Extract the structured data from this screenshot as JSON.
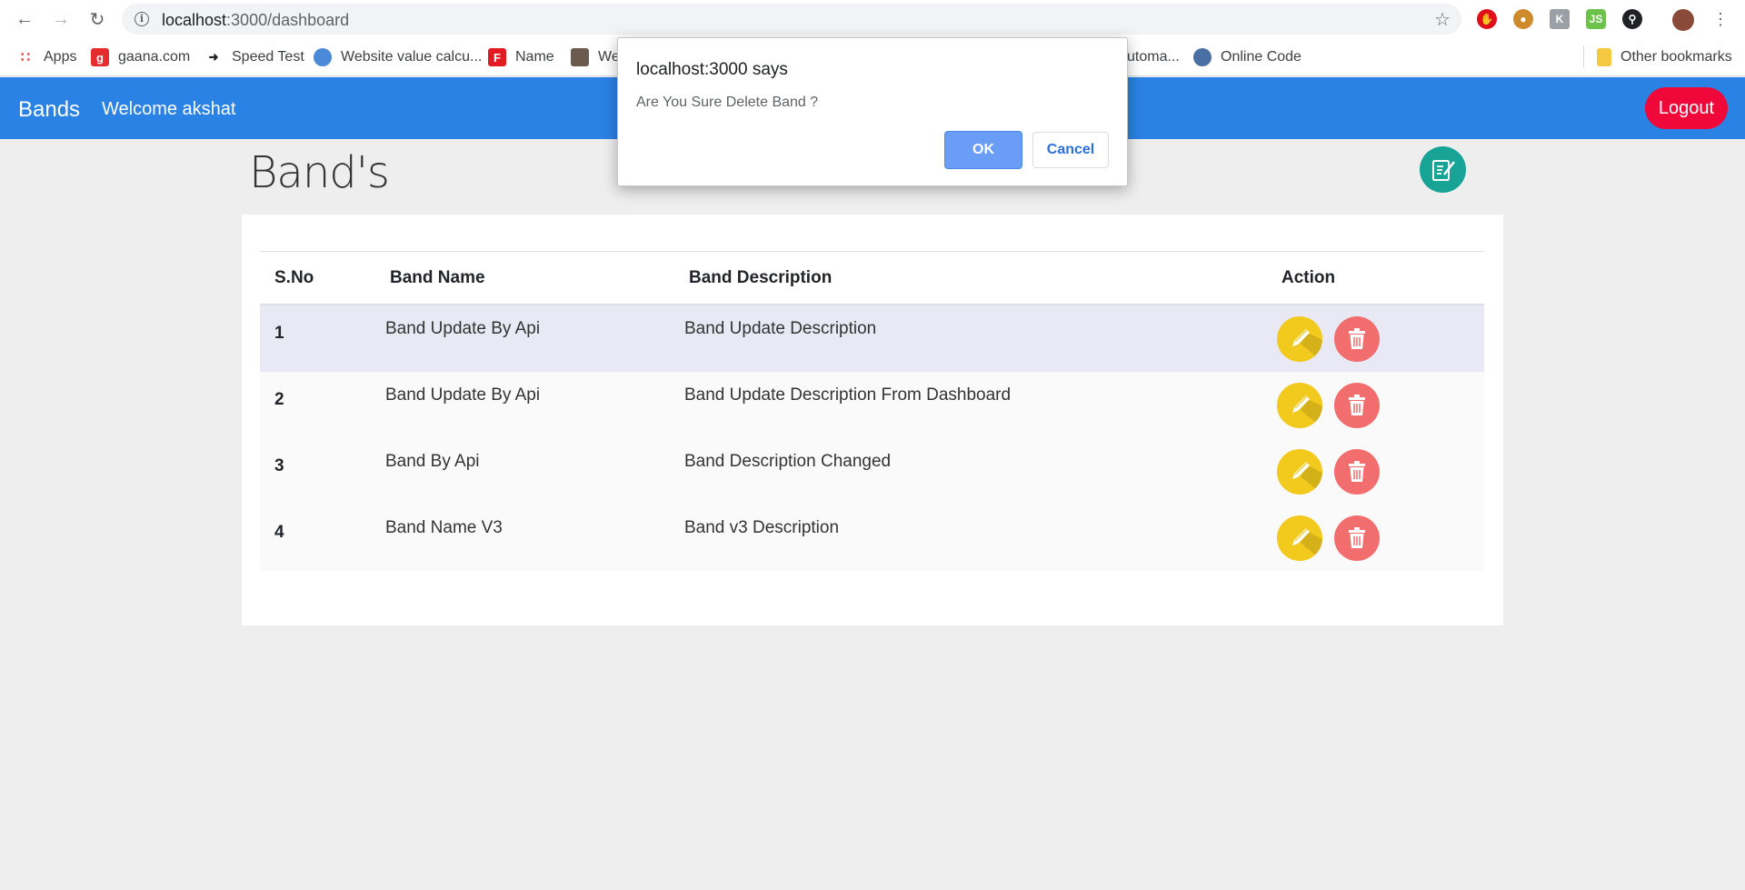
{
  "browser": {
    "url_host": "localhost",
    "url_path": ":3000/dashboard",
    "bookmarks": [
      {
        "label": "Apps"
      },
      {
        "label": "gaana.com"
      },
      {
        "label": "Speed Test"
      },
      {
        "label": "Website value calcu..."
      },
      {
        "label": "Name"
      },
      {
        "label": "We"
      },
      {
        "label": "utoma..."
      },
      {
        "label": "Online Code"
      }
    ],
    "other_bookmarks": "Other bookmarks"
  },
  "navbar": {
    "brand": "Bands",
    "welcome": "Welcome akshat",
    "logout": "Logout"
  },
  "page": {
    "title": "Band's"
  },
  "table": {
    "headers": [
      "S.No",
      "Band Name",
      "Band Description",
      "Action"
    ],
    "rows": [
      {
        "sno": "1",
        "name": "Band Update By Api",
        "description": "Band Update Description"
      },
      {
        "sno": "2",
        "name": "Band Update By Api",
        "description": "Band Update Description From Dashboard"
      },
      {
        "sno": "3",
        "name": "Band By Api",
        "description": "Band Description Changed"
      },
      {
        "sno": "4",
        "name": "Band Name V3",
        "description": "Band v3 Description"
      }
    ]
  },
  "dialog": {
    "title": "localhost:3000 says",
    "message": "Are You Sure Delete Band ?",
    "ok": "OK",
    "cancel": "Cancel"
  },
  "colors": {
    "navbar": "#2a82e4",
    "logout": "#f0083a",
    "edit": "#f2c91d",
    "delete": "#f26d6d",
    "add": "#18a397"
  }
}
